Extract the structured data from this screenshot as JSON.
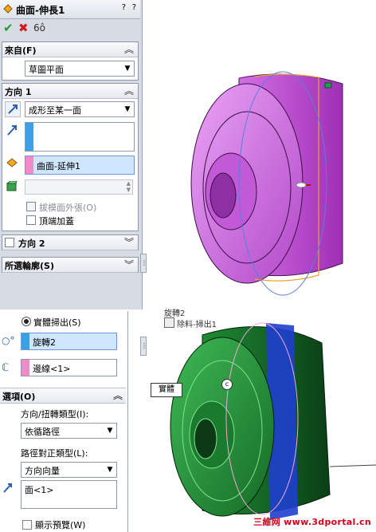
{
  "top_panel": {
    "title": "曲面-伸長1",
    "help_icon": "?",
    "q_icon": "?",
    "from": {
      "header": "來自(F)",
      "value": "草圖平面"
    },
    "direction1": {
      "header": "方向 1",
      "end_condition": "成形至某一面",
      "face_selection": "曲面-延伸1",
      "draft_outward_label": "拔模面外張(O)",
      "cap_end_label": "頂端加蓋"
    },
    "direction2": {
      "header": "方向 2"
    },
    "selected_contours": {
      "header": "所選輪廓(S)"
    }
  },
  "bottom_panel": {
    "solid_sweep_label": "實體掃出(S)",
    "tool_body_value": "旋轉2",
    "path_value": "邊線<1>",
    "options_header": "選項(O)",
    "orientation_label": "方向/扭轉類型(I):",
    "orientation_value": "依循路徑",
    "path_alignment_label": "路徑對正類型(L):",
    "path_alignment_value": "方向向量",
    "direction_vector_value": "面<1>",
    "show_preview_label": "顯示預覽(W)"
  },
  "tree": {
    "item_partial": "旋轉2",
    "item_cut": "除料-掃出1"
  },
  "viewport": {
    "callout_label": "實體",
    "callout_marker": "c"
  },
  "watermark": "三維网 www.3dportal.cn",
  "colors": {
    "pink_part": "#d873e6",
    "green_part": "#1c7a2c",
    "blue_band": "#1f3fcf",
    "selection_stripe": "#3ba0e6",
    "face_stripe": "#f08ac8"
  }
}
